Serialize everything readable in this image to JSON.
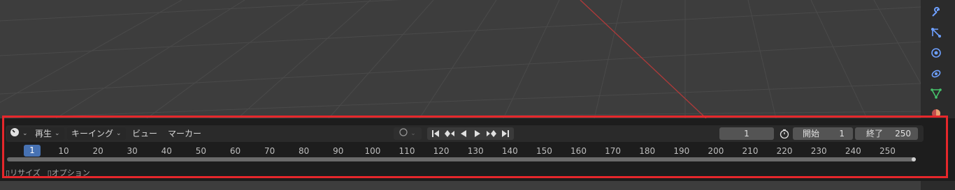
{
  "header": {
    "editor_type_icon": "clock-icon",
    "menus": [
      "再生",
      "キーイング",
      "ビュー",
      "マーカー"
    ]
  },
  "playback": {
    "current_frame": "1",
    "start_label": "開始",
    "start_value": "1",
    "end_label": "終了",
    "end_value": "250"
  },
  "ruler": {
    "current": "1",
    "ticks": [
      "10",
      "20",
      "30",
      "40",
      "50",
      "60",
      "70",
      "80",
      "90",
      "100",
      "110",
      "120",
      "130",
      "140",
      "150",
      "160",
      "170",
      "180",
      "190",
      "200",
      "210",
      "220",
      "230",
      "240",
      "250"
    ]
  },
  "footer": {
    "resize": "リサイズ",
    "options": "オプション"
  },
  "properties_tabs": [
    "wrench-icon",
    "vertex-graph-icon",
    "physics-icon",
    "constraint-icon",
    "object-data-icon",
    "material-icon"
  ],
  "colors": {
    "highlight": "#e6272b",
    "current_frame": "#4772b3",
    "x_axis": "#b13a3a",
    "tab_icon": "#6ea0ff",
    "object_data_icon": "#46c36b"
  }
}
